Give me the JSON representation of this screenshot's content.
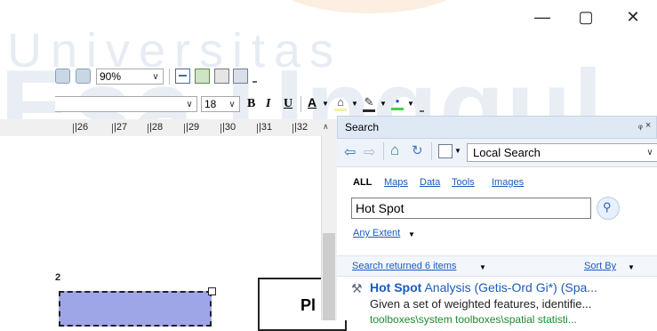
{
  "watermark": {
    "line1": "Universitas",
    "line2": "Esa Unggul"
  },
  "window_controls": {
    "minimize": "—",
    "maximize": "▢",
    "close": "✕"
  },
  "toolbar_top": {
    "zoom_value": "90%"
  },
  "toolbar_format": {
    "font_size": "18",
    "bold": "B",
    "italic": "I",
    "underline": "U",
    "font_color": "A"
  },
  "ruler": {
    "ticks": [
      "|26",
      "|27",
      "|28",
      "|29",
      "|30",
      "|31",
      "|32"
    ]
  },
  "layout": {
    "frame_label": "2",
    "text_fragment": "Pl"
  },
  "search_pane": {
    "title": "Search",
    "pin": "ᵩ ×",
    "scope_value": "Local Search",
    "tabs": {
      "all": "ALL",
      "maps": "Maps",
      "data": "Data",
      "tools": "Tools",
      "images": "Images"
    },
    "query": "Hot Spot",
    "extent_link": "Any Extent",
    "results_summary": "Search returned 6 items",
    "sort_by": "Sort By",
    "results": [
      {
        "title_bold": "Hot Spot",
        "title_rest": " Analysis (Getis-Ord Gi*) (Spa...",
        "description": "Given a set of weighted features, identifie...",
        "path": "toolboxes\\system toolboxes\\spatial statisti..."
      }
    ]
  },
  "colors": {
    "link": "#1a5bbd",
    "pane_header": "#dfe9f5",
    "map_frame_fill": "#9fa6e8",
    "path_green": "#1c8c2f"
  }
}
